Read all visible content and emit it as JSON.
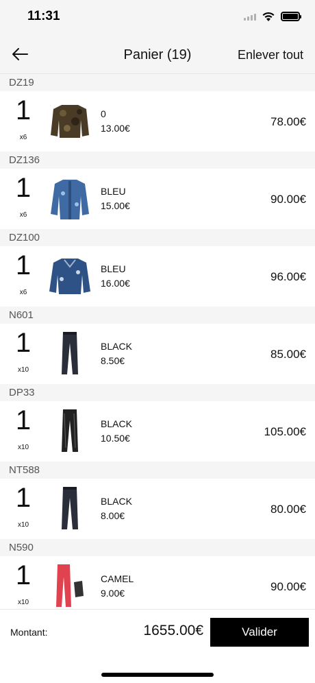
{
  "status_bar": {
    "time": "11:31"
  },
  "nav": {
    "title": "Panier (19)",
    "clear_all": "Enlever tout"
  },
  "groups": [
    {
      "code": "DZ19",
      "qty": "1",
      "multiplier": "x6",
      "color": "0",
      "unit_price": "13.00€",
      "total": "78.00€",
      "thumb_icon": "camo-jacket-icon",
      "thumb_tag": "DZ19#"
    },
    {
      "code": "DZ136",
      "qty": "1",
      "multiplier": "x6",
      "color": "BLEU",
      "unit_price": "15.00€",
      "total": "90.00€",
      "thumb_icon": "denim-coat-icon",
      "thumb_tag": ""
    },
    {
      "code": "DZ100",
      "qty": "1",
      "multiplier": "x6",
      "color": "BLEU",
      "unit_price": "16.00€",
      "total": "96.00€",
      "thumb_icon": "denim-jacket-icon",
      "thumb_tag": ""
    },
    {
      "code": "N601",
      "qty": "1",
      "multiplier": "x10",
      "color": "BLACK",
      "unit_price": "8.50€",
      "total": "85.00€",
      "thumb_icon": "pants-icon",
      "thumb_tag": ""
    },
    {
      "code": "DP33",
      "qty": "1",
      "multiplier": "x10",
      "color": "BLACK",
      "unit_price": "10.50€",
      "total": "105.00€",
      "thumb_icon": "leather-pants-icon",
      "thumb_tag": ""
    },
    {
      "code": "NT588",
      "qty": "1",
      "multiplier": "x10",
      "color": "BLACK",
      "unit_price": "8.00€",
      "total": "80.00€",
      "thumb_icon": "pants-icon",
      "thumb_tag": ""
    },
    {
      "code": "N590",
      "qty": "1",
      "multiplier": "x10",
      "color": "CAMEL",
      "unit_price": "9.00€",
      "total": "90.00€",
      "thumb_icon": "red-pants-icon",
      "thumb_tag": ""
    }
  ],
  "footer": {
    "label": "Montant:",
    "amount": "1655.00€",
    "validate": "Valider"
  },
  "colors": {
    "header_bg": "#f5f5f5",
    "button_bg": "#000000",
    "text": "#111111",
    "group_text": "#555555"
  }
}
